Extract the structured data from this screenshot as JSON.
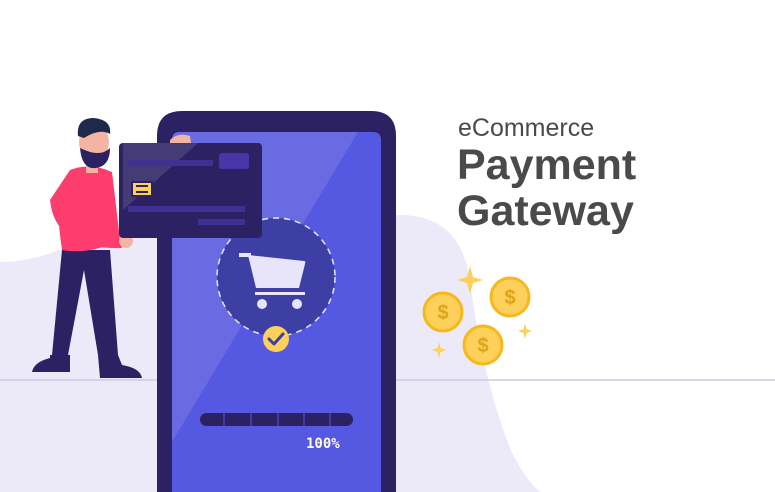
{
  "heading": {
    "subtitle": "eCommerce",
    "title": "Payment Gateway"
  },
  "phone": {
    "progress_label": "100%",
    "progress": 100
  },
  "colors": {
    "phone_frame": "#2c2163",
    "screen": "#5558e0",
    "coin": "#fcd05a",
    "background_blob": "#ece9f8"
  },
  "icons": [
    "cart-icon",
    "check-icon",
    "dollar-coin-icon",
    "sparkle-icon",
    "credit-card",
    "person"
  ]
}
